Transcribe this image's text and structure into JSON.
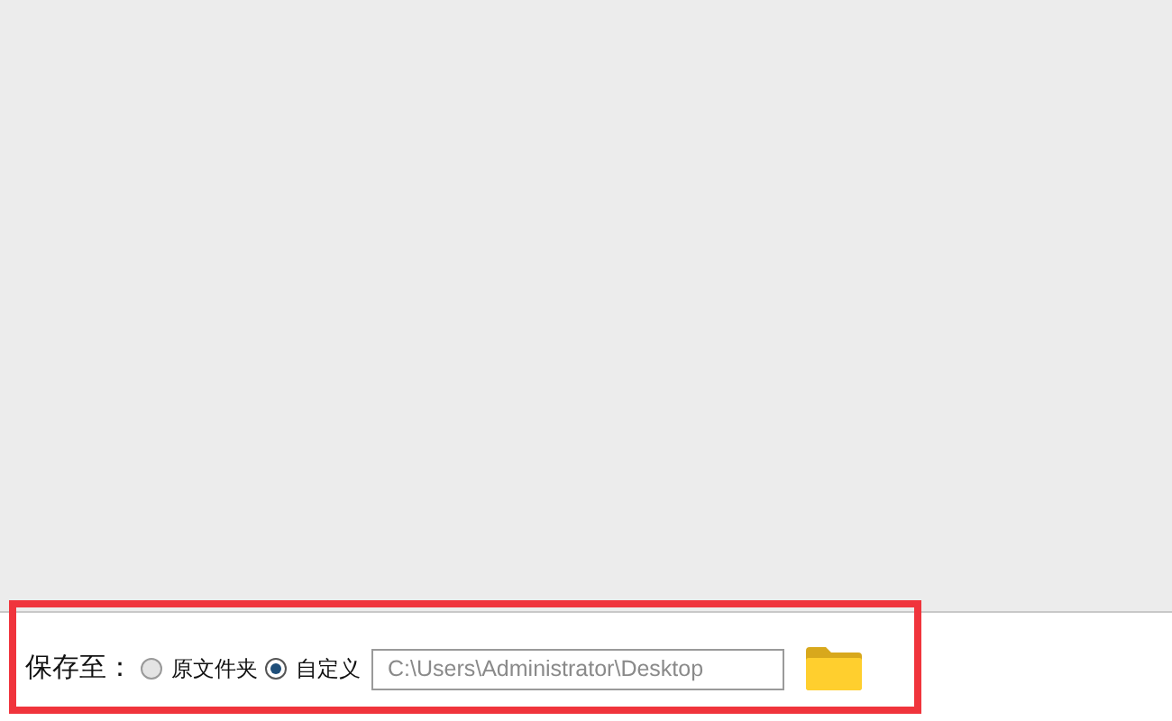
{
  "save_to": {
    "label": "保存至：",
    "options": [
      {
        "label": "原文件夹",
        "selected": false
      },
      {
        "label": "自定义",
        "selected": true
      }
    ],
    "path_field": {
      "placeholder": "C:\\Users\\Administrator\\Desktop"
    }
  }
}
